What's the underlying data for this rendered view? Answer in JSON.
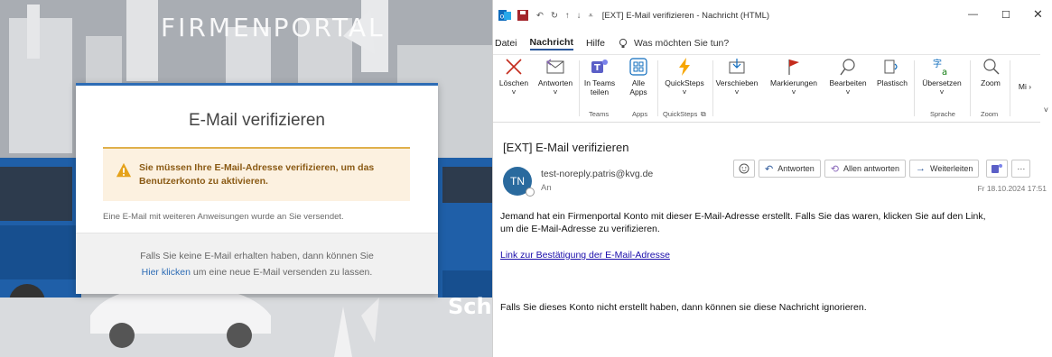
{
  "portal": {
    "brand": "FIRMENPORTAL",
    "bus_text": "Scha",
    "card": {
      "title": "E-Mail verifizieren",
      "alert": "Sie müssen Ihre E-Mail-Adresse verifizieren, um das Benutzerkonto zu aktivieren.",
      "note": "Eine E-Mail mit weiteren Anweisungen wurde an Sie versendet.",
      "footer_line1": "Falls Sie keine E-Mail erhalten haben, dann können Sie",
      "footer_link": "Hier klicken",
      "footer_line2": "um eine neue E-Mail versenden zu lassen."
    },
    "colors": {
      "accent": "#2d6cb5",
      "alert_bg": "#fcf1e0",
      "alert_border": "#e0b04b",
      "alert_text": "#8a5a14"
    }
  },
  "outlook": {
    "window_title": "[EXT] E-Mail verifizieren  -  Nachricht (HTML)",
    "menu": [
      "Datei",
      "Nachricht",
      "Hilfe"
    ],
    "tell_me": "Was möchten Sie tun?",
    "ribbon": {
      "loeschen": "Löschen",
      "antworten": "Antworten",
      "in_teams_teilen": "In Teams teilen",
      "alle_apps": "Alle Apps",
      "quicksteps": "QuickSteps",
      "verschieben": "Verschieben",
      "markierungen": "Markierungen",
      "bearbeiten": "Bearbeiten",
      "plastisch": "Plastisch",
      "uebersetzen": "Übersetzen",
      "zoom": "Zoom",
      "more": "Mi",
      "group_teams": "Teams",
      "group_apps": "Apps",
      "group_quicksteps": "QuickSteps",
      "group_sprache": "Sprache",
      "group_zoom": "Zoom"
    },
    "subject": "[EXT] E-Mail verifizieren",
    "avatar_initials": "TN",
    "sender": "test-noreply.patris@kvg.de",
    "to_label": "An",
    "actions": {
      "reply": "Antworten",
      "reply_all": "Allen antworten",
      "forward": "Weiterleiten"
    },
    "date": "Fr 18.10.2024 17:51",
    "body": {
      "line1": "Jemand hat ein Firmenportal Konto mit dieser E-Mail-Adresse erstellt. Falls Sie das waren, klicken Sie auf den Link,",
      "line2": "um die E-Mail-Adresse zu verifizieren.",
      "link": "Link zur Bestätigung der E-Mail-Adresse",
      "footer": "Falls Sie dieses Konto nicht erstellt haben, dann können sie diese Nachricht ignorieren."
    },
    "colors": {
      "accent": "#2b579a",
      "avatar": "#2a6a9e",
      "link": "#1a0dab"
    }
  }
}
